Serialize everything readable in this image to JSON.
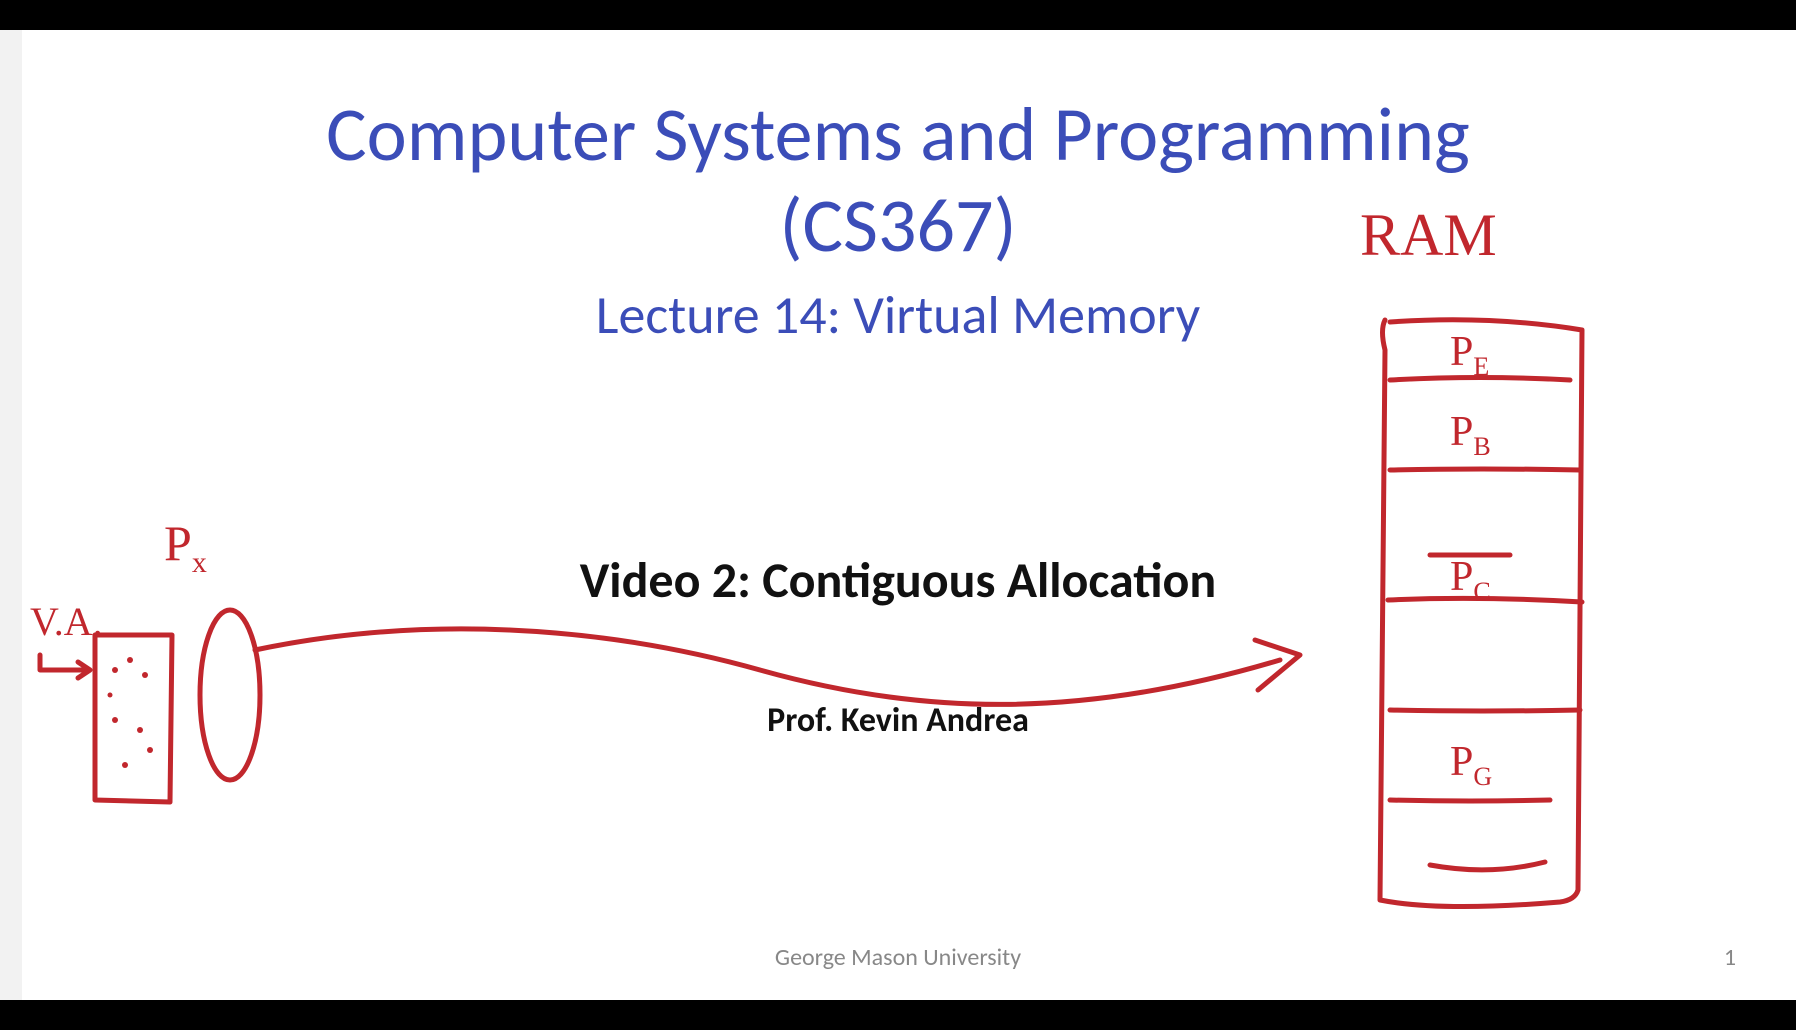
{
  "title_line1": "Computer Systems and Programming",
  "title_line2": "(CS367)",
  "lecture": "Lecture 14: Virtual Memory",
  "video_title": "Video 2: Contiguous Allocation",
  "professor": "Prof. Kevin Andrea",
  "footer": "George Mason University",
  "slide_number": "1",
  "ink": {
    "ram_label": "RAM",
    "va_label": "V.A.",
    "px_label": "P",
    "px_sub": "x",
    "ram_rows": [
      "P",
      "P",
      "",
      "P",
      "",
      "P",
      ""
    ],
    "ram_subs": [
      "E",
      "B",
      "",
      "C",
      "",
      "G",
      ""
    ]
  }
}
